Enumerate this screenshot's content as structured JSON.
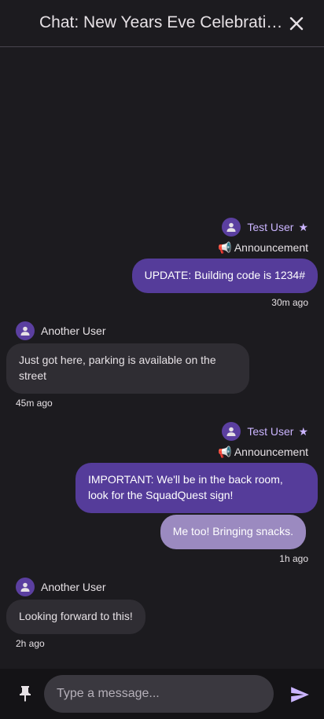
{
  "header": {
    "title": "Chat: New Years Eve Celebration",
    "close_icon": "close-icon"
  },
  "messages": [
    {
      "sender": "Test User",
      "star": "★",
      "tag": "📢 Announcement",
      "bubbles": [
        "UPDATE: Building code is 1234#"
      ],
      "time": "30m ago"
    },
    {
      "sender": "Another User",
      "bubbles": [
        "Just got here, parking is available on the street"
      ],
      "time": "45m ago"
    },
    {
      "sender": "Test User",
      "star": "★",
      "tag": "📢 Announcement",
      "bubbles": [
        "IMPORTANT: We'll be in the back room, look for the SquadQuest sign!",
        "Me too! Bringing snacks."
      ],
      "time": "1h ago"
    },
    {
      "sender": "Another User",
      "bubbles": [
        "Looking forward to this!"
      ],
      "time": "2h ago"
    }
  ],
  "composer": {
    "placeholder": "Type a message...",
    "pin_icon": "pin-icon",
    "send_icon": "send-icon"
  },
  "colors": {
    "background": "#1c1b1f",
    "my_bubble": "#553c9a",
    "my_bubble_light": "#9b8ac0",
    "other_bubble": "#2f2d33",
    "accent": "#cbb5ff"
  }
}
